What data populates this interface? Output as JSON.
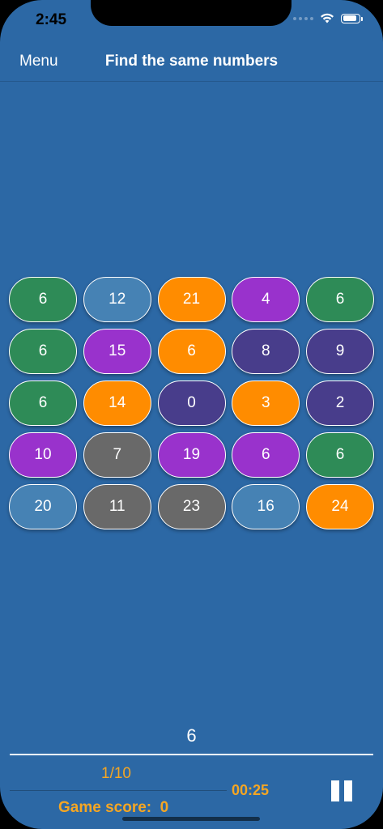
{
  "status": {
    "time": "2:45"
  },
  "navbar": {
    "menu_label": "Menu",
    "title": "Find the same numbers"
  },
  "colors": {
    "background": "#2c68a5",
    "accent": "#f5a623",
    "tile_green": "#2e8b57",
    "tile_steel": "#4682b4",
    "tile_orange": "#ff8c00",
    "tile_purple": "#9932cc",
    "tile_indigo": "#483d8b",
    "tile_gray": "#696969"
  },
  "grid": {
    "tiles": [
      {
        "value": "6",
        "color": "green"
      },
      {
        "value": "12",
        "color": "steel"
      },
      {
        "value": "21",
        "color": "orange"
      },
      {
        "value": "4",
        "color": "purple"
      },
      {
        "value": "6",
        "color": "green"
      },
      {
        "value": "6",
        "color": "green"
      },
      {
        "value": "15",
        "color": "purple"
      },
      {
        "value": "6",
        "color": "orange"
      },
      {
        "value": "8",
        "color": "indigo"
      },
      {
        "value": "9",
        "color": "indigo"
      },
      {
        "value": "6",
        "color": "green"
      },
      {
        "value": "14",
        "color": "orange"
      },
      {
        "value": "0",
        "color": "indigo"
      },
      {
        "value": "3",
        "color": "orange"
      },
      {
        "value": "2",
        "color": "indigo"
      },
      {
        "value": "10",
        "color": "purple"
      },
      {
        "value": "7",
        "color": "gray"
      },
      {
        "value": "19",
        "color": "purple"
      },
      {
        "value": "6",
        "color": "purple"
      },
      {
        "value": "6",
        "color": "green"
      },
      {
        "value": "20",
        "color": "steel"
      },
      {
        "value": "11",
        "color": "gray"
      },
      {
        "value": "23",
        "color": "gray"
      },
      {
        "value": "16",
        "color": "steel"
      },
      {
        "value": "24",
        "color": "orange"
      }
    ]
  },
  "game": {
    "target_number": "6",
    "progress": "1/10",
    "timer": "00:25",
    "score_text": "Game score:  0"
  },
  "icons": {
    "wifi": "wifi-icon",
    "battery": "battery-icon",
    "signal": "cellular-signal-icon",
    "pause": "pause-icon"
  }
}
